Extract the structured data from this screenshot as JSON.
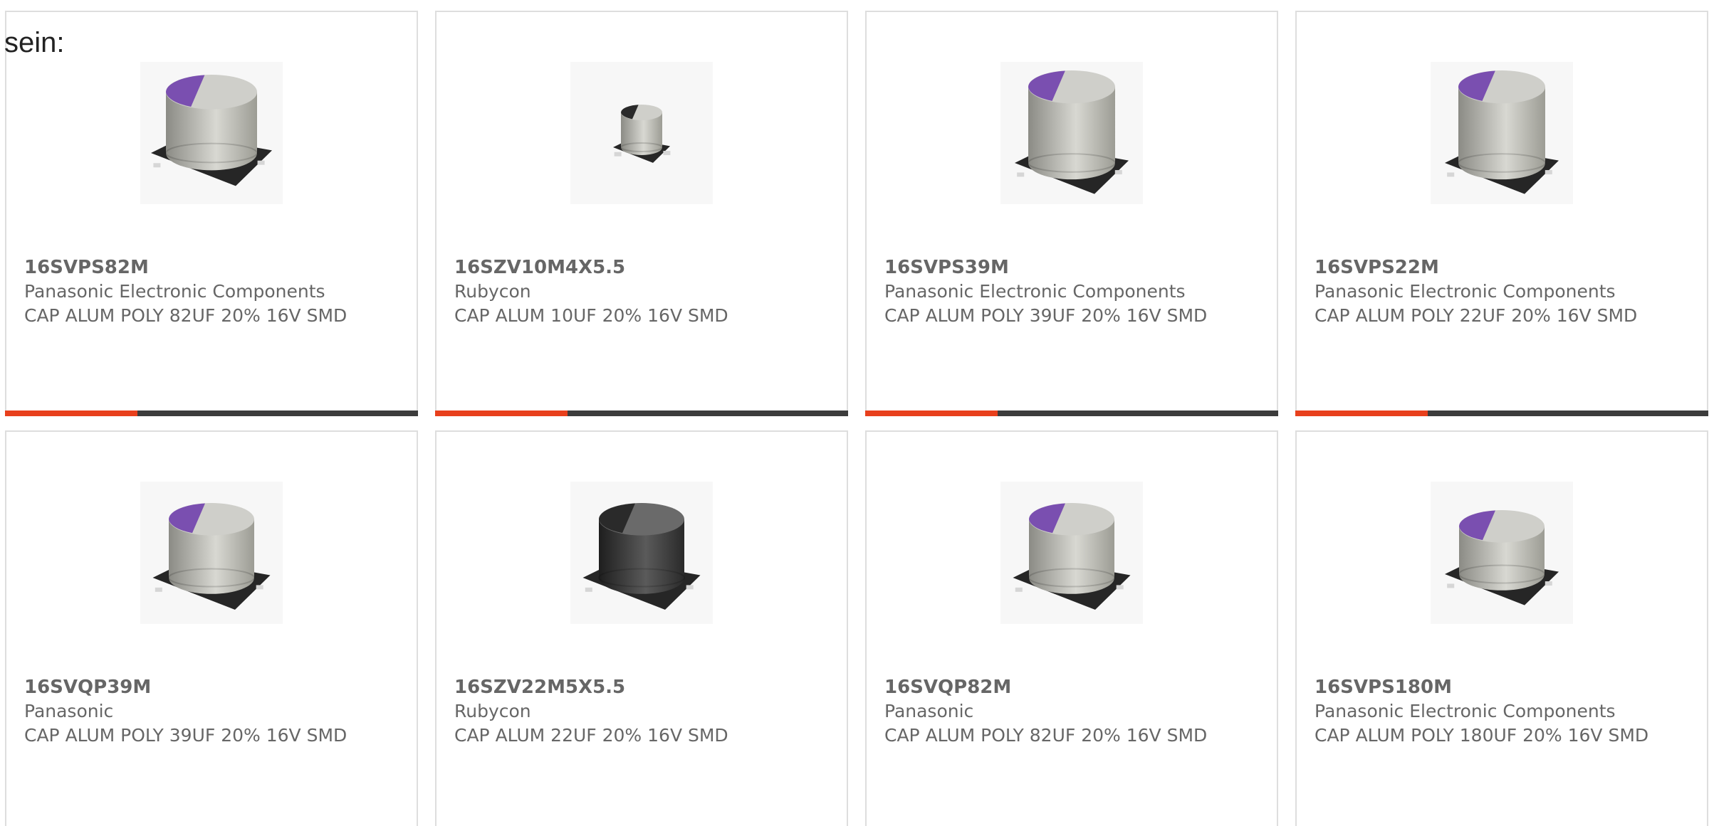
{
  "intro_text": "sein:",
  "colors": {
    "card_border": "#dedede",
    "text_gray": "#666666",
    "bar_dark": "#3c3c3c",
    "bar_accent": "#e8401c",
    "poly_stripe": "#7a4fb0"
  },
  "products": [
    {
      "part": "16SVPS82M",
      "maker": "Panasonic Electronic Components",
      "description": "CAP ALUM POLY 82UF 20% 16V SMD",
      "image": "polymer-capacitor-purple-stripe-icon",
      "size": "large",
      "progress": 0.32
    },
    {
      "part": "16SZV10M4X5.5",
      "maker": "Rubycon",
      "description": "CAP ALUM 10UF 20% 16V SMD",
      "image": "aluminum-capacitor-black-stripe-icon",
      "size": "small",
      "progress": 0.32
    },
    {
      "part": "16SVPS39M",
      "maker": "Panasonic Electronic Components",
      "description": "CAP ALUM POLY 39UF 20% 16V SMD",
      "image": "polymer-capacitor-purple-stripe-icon",
      "size": "tall",
      "progress": 0.32
    },
    {
      "part": "16SVPS22M",
      "maker": "Panasonic Electronic Components",
      "description": "CAP ALUM POLY 22UF 20% 16V SMD",
      "image": "polymer-capacitor-purple-stripe-icon",
      "size": "tall",
      "progress": 0.32
    },
    {
      "part": "16SVQP39M",
      "maker": "Panasonic",
      "description": "CAP ALUM POLY 39UF 20% 16V SMD",
      "image": "polymer-capacitor-purple-stripe-icon",
      "size": "medium",
      "progress": null
    },
    {
      "part": "16SZV22M5X5.5",
      "maker": "Rubycon",
      "description": "CAP ALUM 22UF 20% 16V SMD",
      "image": "aluminum-capacitor-dark-icon",
      "size": "medium",
      "progress": null
    },
    {
      "part": "16SVQP82M",
      "maker": "Panasonic",
      "description": "CAP ALUM POLY 82UF 20% 16V SMD",
      "image": "polymer-capacitor-purple-stripe-icon",
      "size": "medium",
      "progress": null
    },
    {
      "part": "16SVPS180M",
      "maker": "Panasonic Electronic Components",
      "description": "CAP ALUM POLY 180UF 20% 16V SMD",
      "image": "polymer-capacitor-purple-stripe-icon",
      "size": "flat",
      "progress": null
    }
  ]
}
